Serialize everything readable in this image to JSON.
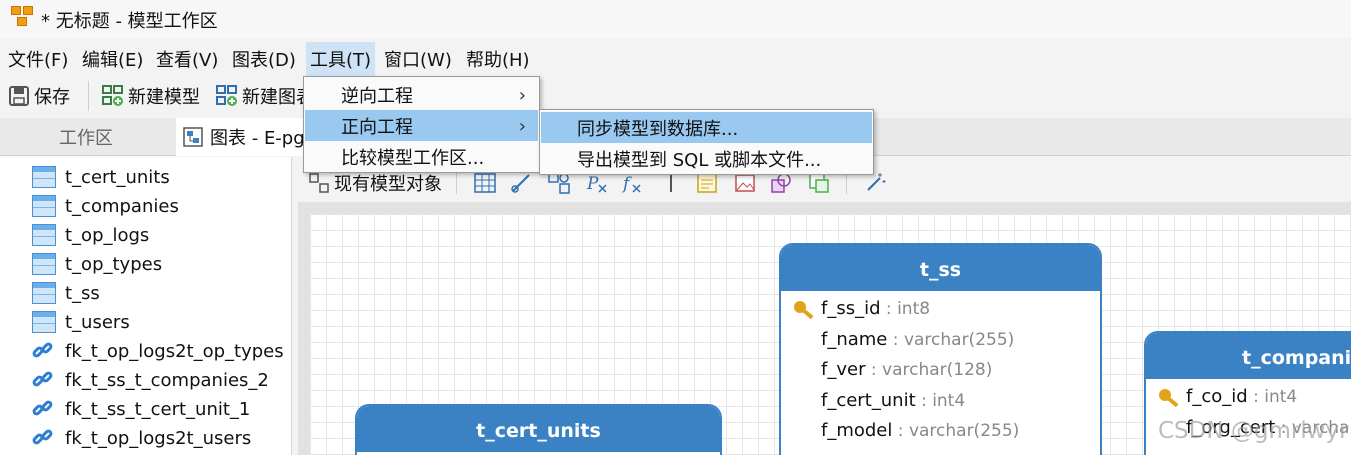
{
  "window": {
    "title": "* 无标题 - 模型工作区"
  },
  "menubar": {
    "items": [
      {
        "label": "文件(F)"
      },
      {
        "label": "编辑(E)"
      },
      {
        "label": "查看(V)"
      },
      {
        "label": "图表(D)"
      },
      {
        "label": "工具(T)"
      },
      {
        "label": "窗口(W)"
      },
      {
        "label": "帮助(H)"
      }
    ]
  },
  "toolbar": {
    "save": "保存",
    "new_model": "新建模型",
    "new_diagram": "新建图表"
  },
  "tabs": {
    "workspace": "工作区",
    "diagram": "图表 - E-pg"
  },
  "sidebar": {
    "items": [
      {
        "label": "t_cert_units",
        "kind": "table"
      },
      {
        "label": "t_companies",
        "kind": "table"
      },
      {
        "label": "t_op_logs",
        "kind": "table"
      },
      {
        "label": "t_op_types",
        "kind": "table"
      },
      {
        "label": "t_ss",
        "kind": "table"
      },
      {
        "label": "t_users",
        "kind": "table"
      },
      {
        "label": "fk_t_op_logs2t_op_types",
        "kind": "foreign-key"
      },
      {
        "label": "fk_t_ss_t_companies_2",
        "kind": "foreign-key"
      },
      {
        "label": "fk_t_ss_t_cert_unit_1",
        "kind": "foreign-key"
      },
      {
        "label": "fk_t_op_logs2t_users",
        "kind": "foreign-key"
      }
    ]
  },
  "canvas_toolbar": {
    "existing_objects": "现有模型对象"
  },
  "tools_menu": {
    "items": [
      {
        "label": "逆向工程",
        "submenu": true
      },
      {
        "label": "正向工程",
        "submenu": true,
        "highlighted": true
      },
      {
        "label": "比较模型工作区...",
        "submenu": false
      }
    ],
    "forward_submenu": [
      {
        "label": "同步模型到数据库...",
        "highlighted": true
      },
      {
        "label": "导出模型到 SQL 或脚本文件..."
      }
    ]
  },
  "entities": {
    "t_ss": {
      "name": "t_ss",
      "fields": [
        {
          "name": "f_ss_id",
          "type": "int8",
          "pk": true
        },
        {
          "name": "f_name",
          "type": "varchar(255)"
        },
        {
          "name": "f_ver",
          "type": "varchar(128)"
        },
        {
          "name": "f_cert_unit",
          "type": "int4"
        },
        {
          "name": "f_model",
          "type": "varchar(255)"
        }
      ]
    },
    "t_companies": {
      "name": "t_compani",
      "fields": [
        {
          "name": "f_co_id",
          "type": "int4",
          "pk": true
        },
        {
          "name": "f_org_cert",
          "type": "varchar"
        }
      ]
    },
    "t_cert_units": {
      "name": "t_cert_units"
    }
  },
  "watermark": "CSDN @gmrlwyr",
  "colors": {
    "entity_header": "#3b82c4",
    "menu_highlight": "#99c9f1",
    "key_icon": "#e3a21a"
  }
}
